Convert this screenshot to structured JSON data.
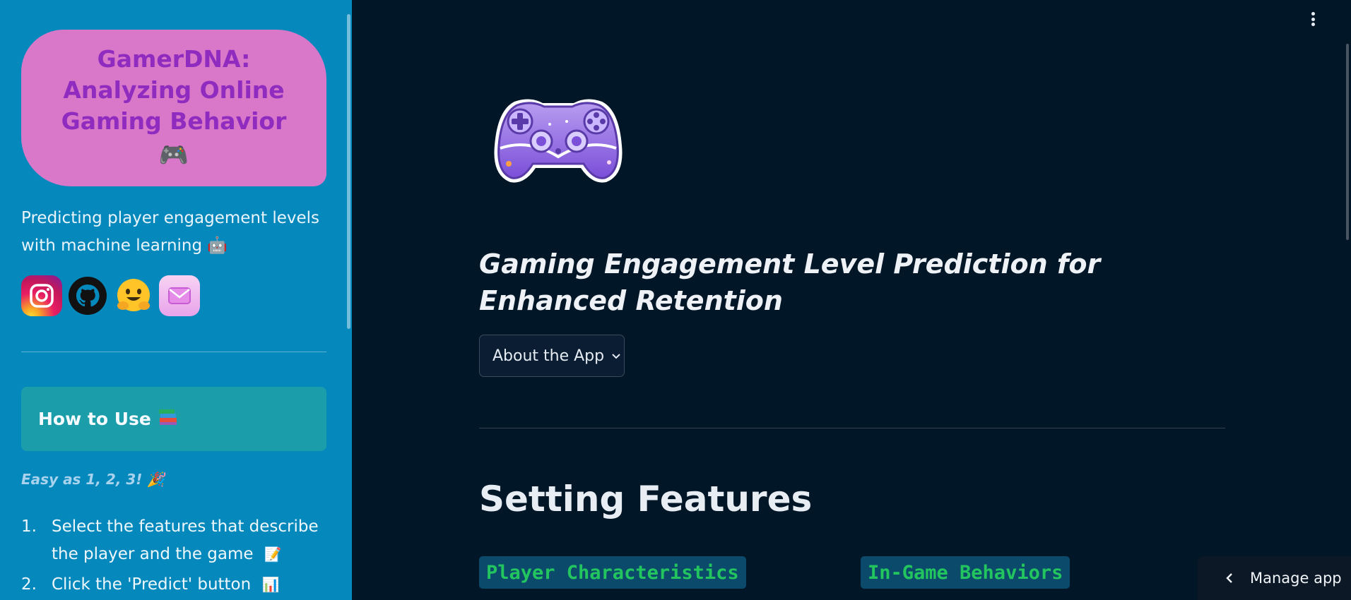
{
  "sidebar": {
    "title": "GamerDNA: Analyzing Online Gaming Behavior",
    "title_emoji": "🎮",
    "tagline": "Predicting player engagement levels with machine learning",
    "tagline_emoji": "🤖",
    "socials": [
      {
        "name": "instagram",
        "icon": "instagram-icon"
      },
      {
        "name": "github",
        "icon": "github-icon"
      },
      {
        "name": "huggingface",
        "icon": "hugging-face-icon"
      },
      {
        "name": "email",
        "icon": "mail-icon"
      }
    ],
    "howto": {
      "label": "How to Use",
      "emoji": "📚"
    },
    "easy_text": "Easy as 1, 2, 3!",
    "easy_emoji": "🎉",
    "steps": [
      {
        "num": "1.",
        "text": "Select the features that describe the player and the game",
        "emoji": "📝"
      },
      {
        "num": "2.",
        "text": "Click the 'Predict' button",
        "emoji": "📊"
      }
    ]
  },
  "main": {
    "title": "Gaming Engagement Level Prediction for Enhanced Retention",
    "expander_label": "About the App",
    "section_title": "Setting Features",
    "player_label": "Player Characteristics",
    "ingame_label": "In-Game Behaviors",
    "manage_app": "Manage app"
  },
  "colors": {
    "sidebar_bg": "#0589bd",
    "main_bg": "#011627",
    "title_card": "#d977c9",
    "title_text": "#8f2bbf",
    "howto_card": "#1b9ea9",
    "code_green": "#22c55e"
  }
}
